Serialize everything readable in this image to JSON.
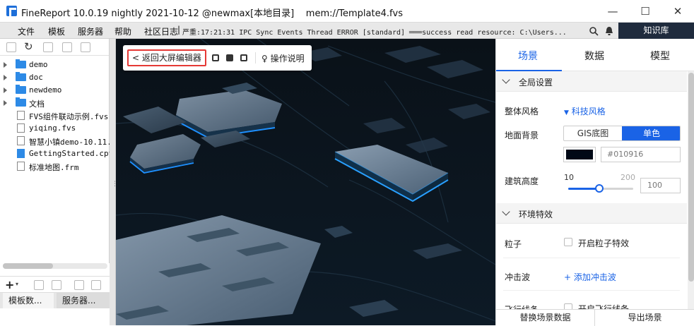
{
  "window": {
    "title": "FineReport 10.0.19 nightly 2021-10-12 @newmax[本地目录]",
    "path": "mem://Template4.fvs",
    "minimize": "—",
    "maximize": "☐",
    "close": "✕"
  },
  "menu": {
    "items": [
      "文件",
      "模板",
      "服务器",
      "帮助",
      "社区日志"
    ],
    "separator": "|",
    "log_text": "严重:17:21:31 IPC Sync Events Thread ERROR [standard] ═══success read resource: C:\\Users...",
    "knowledge": "知识库"
  },
  "file_tree": {
    "items": [
      {
        "label": "demo",
        "type": "folder"
      },
      {
        "label": "doc",
        "type": "folder"
      },
      {
        "label": "newdemo",
        "type": "folder"
      },
      {
        "label": "文档",
        "type": "folder"
      },
      {
        "label": "FVS组件联动示例.fvs",
        "type": "file"
      },
      {
        "label": "yiqing.fvs",
        "type": "file"
      },
      {
        "label": "智慧小镇demo-10.11.",
        "type": "file"
      },
      {
        "label": "GettingStarted.cpt",
        "type": "file-blue"
      },
      {
        "label": "标准地图.frm",
        "type": "file"
      }
    ],
    "bottom_tabs": [
      "模板数...",
      "服务器..."
    ]
  },
  "scene_toolbar": {
    "back_label": "返回大屏编辑器",
    "help_label": "操作说明"
  },
  "right_panel": {
    "tabs": [
      "场景",
      "数据",
      "模型"
    ],
    "active_tab": 0,
    "global_section": "全局设置",
    "style_label": "整体风格",
    "style_value": "科技风格",
    "ground_label": "地面背景",
    "ground_options": [
      "GIS底图",
      "单色"
    ],
    "ground_selected": "单色",
    "ground_color": "#010916",
    "ground_hex": "#010916",
    "building_label": "建筑高度",
    "building_min": "10",
    "building_max": "200",
    "building_value": "100",
    "env_section": "环境特效",
    "particle_label": "粒子",
    "particle_check": "开启粒子特效",
    "shock_label": "冲击波",
    "shock_add": "+ 添加冲击波",
    "fly_label": "飞行线条",
    "fly_check": "开启飞行线条",
    "footer_buttons": [
      "替换场景数据",
      "导出场景"
    ]
  },
  "colors": {
    "accent": "#1a63e6",
    "scene_bg": "#0b1520",
    "highlight_border": "#e53935"
  }
}
